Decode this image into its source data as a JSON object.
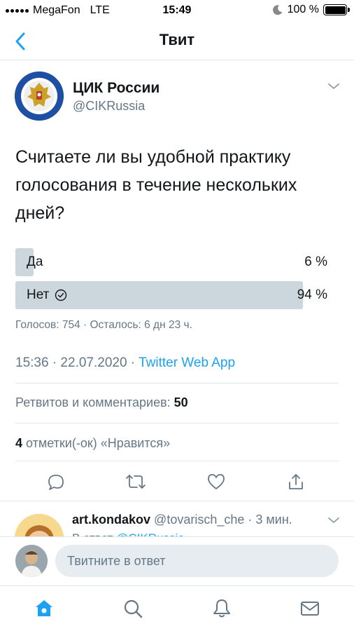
{
  "status_bar": {
    "carrier": "MegaFon",
    "network": "LTE",
    "time": "15:49",
    "battery": "100 %"
  },
  "header": {
    "title": "Твит",
    "back_icon": "chevron-left-icon"
  },
  "tweet": {
    "author_name": "ЦИК России",
    "author_handle": "@CIKRussia",
    "text": "Считаете ли вы удобной практику голосования в течение нескольких дней?",
    "poll": {
      "options": [
        {
          "label": "Да",
          "percent_text": "6 %",
          "percent": 6,
          "selected": false
        },
        {
          "label": "Нет",
          "percent_text": "94 %",
          "percent": 94,
          "selected": true
        }
      ],
      "meta": "Голосов: 754 · Осталось: 6 дн 23 ч."
    },
    "time": "15:36 · 22.07.2020 · ",
    "source": "Twitter Web App",
    "retweets_label": "Ретвитов и комментариев: ",
    "retweets_count": "50",
    "likes_count": "4",
    "likes_label": " отметки(-ок) «Нравится»",
    "action_icons": [
      "comment-icon",
      "retweet-icon",
      "like-icon",
      "share-icon"
    ]
  },
  "reply": {
    "name": "art.kondakov",
    "meta": " @tovarisch_che · 3 мин.",
    "reply_to_prefix": "В ответ ",
    "reply_to_mention": "@CIKRussia"
  },
  "compose": {
    "placeholder": "Твитните в ответ"
  },
  "tabbar": {
    "icons": [
      "home-icon",
      "search-icon",
      "notifications-icon",
      "messages-icon"
    ]
  },
  "colors": {
    "accent": "#1da1f2",
    "secondary_text": "#657786",
    "poll_bar": "#ccd6dd"
  }
}
